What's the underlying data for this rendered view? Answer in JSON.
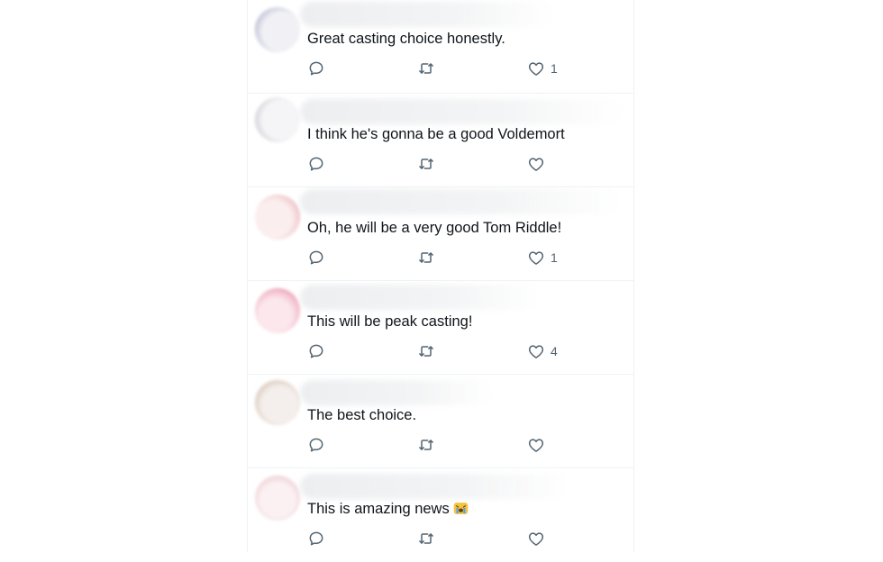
{
  "replies": [
    {
      "text": "Great casting choice honestly.",
      "likes": "1",
      "avatar_color": "#dcdde6",
      "avatar_edge": "#3b3f6a"
    },
    {
      "text": "I think he's gonna be a good Voldemort",
      "likes": "",
      "avatar_color": "#e7e7ea",
      "avatar_edge": "#2d2d33"
    },
    {
      "text": "Oh, he will be a very good Tom Riddle!",
      "likes": "1",
      "avatar_color": "#f6dede",
      "avatar_edge": "#c0304c"
    },
    {
      "text": "This will be peak casting!",
      "likes": "4",
      "avatar_color": "#f7d3dd",
      "avatar_edge": "#d4184e"
    },
    {
      "text": "The best choice.",
      "likes": "",
      "avatar_color": "#eadfda",
      "avatar_edge": "#8a5a2a"
    },
    {
      "text": "This is amazing news",
      "likes": "",
      "avatar_color": "#f4dfe2",
      "avatar_edge": "#d8a0a8",
      "emoji": "crying-emoji"
    }
  ],
  "icons": {
    "reply": "reply-icon",
    "retweet": "retweet-icon",
    "like": "heart-icon"
  },
  "colors": {
    "text": "#0f1419",
    "secondary": "#536471",
    "divider": "#eff3f4"
  }
}
